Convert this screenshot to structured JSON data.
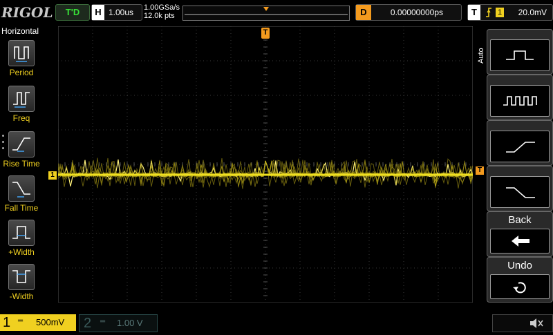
{
  "brand": "RIGOL",
  "status": {
    "run_state": "T'D"
  },
  "horizontal_scale": {
    "key": "H",
    "value": "1.00us"
  },
  "acquisition": {
    "sample_rate": "1.00GSa/s",
    "points": "12.0k pts"
  },
  "delay": {
    "key": "D",
    "value": "0.00000000ps"
  },
  "trigger": {
    "key": "T",
    "source_badge": "1",
    "level": "20.0mV"
  },
  "left_menu": {
    "title": "Horizontal",
    "items": [
      {
        "label": "Period",
        "icon": "period-icon"
      },
      {
        "label": "Freq",
        "icon": "frequency-icon"
      },
      {
        "label": "Rise Time",
        "icon": "rise-time-icon"
      },
      {
        "label": "Fall Time",
        "icon": "fall-time-icon"
      },
      {
        "label": "+Width",
        "icon": "positive-width-icon"
      },
      {
        "label": "-Width",
        "icon": "negative-width-icon"
      }
    ]
  },
  "right_menu": {
    "mode_label": "Auto",
    "back_label": "Back",
    "undo_label": "Undo",
    "items": [
      {
        "icon": "single-pulse-icon"
      },
      {
        "icon": "pulse-train-icon"
      },
      {
        "icon": "rising-edge-icon"
      },
      {
        "icon": "falling-edge-icon"
      }
    ]
  },
  "markers": {
    "ch1_badge": "1",
    "trigger_pos_badge": "T",
    "trigger_level_badge": "T"
  },
  "channels": [
    {
      "number": "1",
      "coupling": "DC",
      "scale": "500mV",
      "color": "#f0d020",
      "active": true
    },
    {
      "number": "2",
      "coupling": "DC",
      "scale": "1.00 V",
      "color": "#3a6a6a",
      "active": false
    }
  ],
  "colors": {
    "trace": "#f0e020",
    "grid": "#3a3a3a",
    "delay_key": "#f39a1e",
    "run_text": "#38e038"
  }
}
